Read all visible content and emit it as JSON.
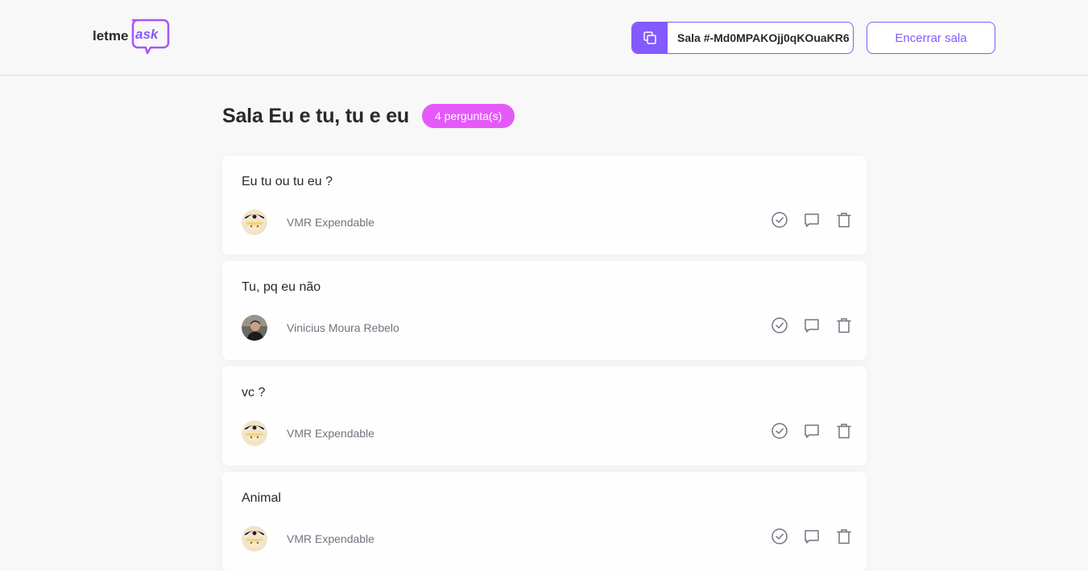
{
  "header": {
    "logo_text_prefix": "letme",
    "logo_text_suffix": "ask",
    "room_code_label": "Sala #-Md0MPAKOjj0qKOuaKR6",
    "close_room_label": "Encerrar sala"
  },
  "room": {
    "title": "Sala Eu e tu, tu e eu",
    "question_count": "4 pergunta(s)"
  },
  "questions": [
    {
      "content": "Eu tu ou tu eu ?",
      "author": "VMR Expendable"
    },
    {
      "content": "Tu, pq eu não",
      "author": "Vinicius Moura Rebelo"
    },
    {
      "content": "vc ?",
      "author": "VMR Expendable"
    },
    {
      "content": "Animal",
      "author": "VMR Expendable"
    }
  ],
  "icons": {
    "copy": "copy-icon",
    "check": "check-circle-icon",
    "answer": "answer-balloon-icon",
    "delete": "delete-trash-icon"
  },
  "colors": {
    "brand": "#835afd",
    "badge": "#e559f9",
    "text": "#29292e",
    "muted": "#737380",
    "icon": "#737380"
  }
}
